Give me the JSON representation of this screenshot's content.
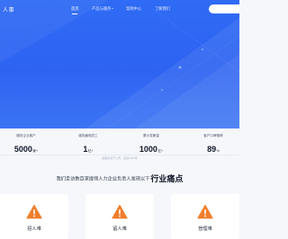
{
  "nav": {
    "logo": "人事",
    "items": [
      {
        "label": "首页",
        "active": true,
        "dropdown": false
      },
      {
        "label": "产品与服务",
        "active": false,
        "dropdown": true
      },
      {
        "label": "案例中心",
        "active": false,
        "dropdown": false
      },
      {
        "label": "了解我们",
        "active": false,
        "dropdown": false
      }
    ]
  },
  "stats": [
    {
      "label": "服务企业客户",
      "value": "5000",
      "unit": "家+"
    },
    {
      "label": "服务雇佣员工",
      "value": "1",
      "unit": "亿+"
    },
    {
      "label": "累计发薪量",
      "value": "1000",
      "unit": "亿+"
    },
    {
      "label": "客户口碑推荐",
      "value": "89",
      "unit": "%"
    }
  ],
  "footnote": "数据来源于公司，截至2023年",
  "pain": {
    "lead": "我们走访数百家提领人力企业负责人发现以下",
    "emphasis": "行业痛点",
    "cards": [
      {
        "label": "招人难",
        "icon": "warning-icon"
      },
      {
        "label": "留人难",
        "icon": "warning-icon"
      },
      {
        "label": "管理难",
        "icon": "warning-icon"
      }
    ]
  },
  "colors": {
    "hero": "#2f6bf4",
    "warning": "#f07e2c",
    "background": "#f5f7fb"
  }
}
